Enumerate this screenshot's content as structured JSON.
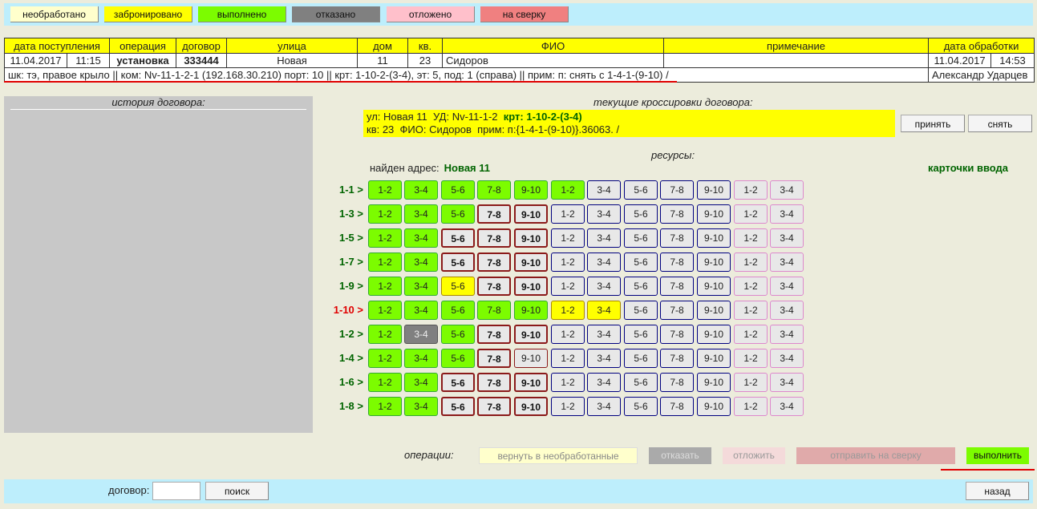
{
  "statuses": [
    {
      "label": "необработано",
      "color": "#ffffcc"
    },
    {
      "label": "забронировано",
      "color": "#ffff00"
    },
    {
      "label": "выполнено",
      "color": "#7cfc00"
    },
    {
      "label": "отказано",
      "color": "#808080"
    },
    {
      "label": "отложено",
      "color": "#ffc0cb"
    },
    {
      "label": "на сверку",
      "color": "#f08080"
    }
  ],
  "table": {
    "headers": [
      "дата поступления",
      "операция",
      "договор",
      "улица",
      "дом",
      "кв.",
      "ФИО",
      "примечание",
      "дата обработки"
    ],
    "values": {
      "date_in": "11.04.2017",
      "time_in": "11:15",
      "operation": "установка",
      "contract": "333444",
      "street": "Новая",
      "house": "11",
      "apt": "23",
      "fio": "Сидоров",
      "note": "",
      "date_out": "11.04.2017",
      "time_out": "14:53"
    },
    "details": "шк: тэ, правое крыло || ком: Nv-11-1-2-1 (192.168.30.210) порт: 10 || крт: 1-10-2-(3-4), эт: 5, под: 1 (справа) || прим: п: снять с 1-4-1-(9-10) /",
    "operator": "Александр Ударцев"
  },
  "history": {
    "title": "история договора:"
  },
  "current": {
    "title": "текущие кроссировки договора:",
    "line1_prefix": "ул: Новая 11  УД: Nv-11-1-2  ",
    "line1_hl": "крт: 1-10-2-(3-4)",
    "line2": "кв: 23  ФИО: Сидоров  прим: п:{1-4-1-(9-10)}.36063. /",
    "accept_label": "принять",
    "remove_label": "снять"
  },
  "resources": {
    "title": "ресурсы:",
    "found_label": "найден адрес:",
    "found_value": "Новая 11",
    "cards_label": "карточки ввода",
    "rows": [
      {
        "label": "1-1 >",
        "red": false,
        "cells": [
          [
            "1-2",
            "g"
          ],
          [
            "3-4",
            "g"
          ],
          [
            "5-6",
            "g"
          ],
          [
            "7-8",
            "g"
          ],
          [
            "9-10",
            "g"
          ],
          [
            "1-2",
            "g"
          ],
          [
            "3-4",
            "n"
          ],
          [
            "5-6",
            "n"
          ],
          [
            "7-8",
            "n"
          ],
          [
            "9-10",
            "n"
          ],
          [
            "1-2",
            "p"
          ],
          [
            "3-4",
            "p"
          ]
        ]
      },
      {
        "label": "1-3 >",
        "red": false,
        "cells": [
          [
            "1-2",
            "g"
          ],
          [
            "3-4",
            "g"
          ],
          [
            "5-6",
            "g"
          ],
          [
            "7-8",
            "b"
          ],
          [
            "9-10",
            "b"
          ],
          [
            "1-2",
            "n"
          ],
          [
            "3-4",
            "n"
          ],
          [
            "5-6",
            "n"
          ],
          [
            "7-8",
            "n"
          ],
          [
            "9-10",
            "n"
          ],
          [
            "1-2",
            "p"
          ],
          [
            "3-4",
            "p"
          ]
        ]
      },
      {
        "label": "1-5 >",
        "red": false,
        "cells": [
          [
            "1-2",
            "g"
          ],
          [
            "3-4",
            "g"
          ],
          [
            "5-6",
            "b"
          ],
          [
            "7-8",
            "b"
          ],
          [
            "9-10",
            "b"
          ],
          [
            "1-2",
            "n"
          ],
          [
            "3-4",
            "n"
          ],
          [
            "5-6",
            "n"
          ],
          [
            "7-8",
            "n"
          ],
          [
            "9-10",
            "n"
          ],
          [
            "1-2",
            "p"
          ],
          [
            "3-4",
            "p"
          ]
        ]
      },
      {
        "label": "1-7 >",
        "red": false,
        "cells": [
          [
            "1-2",
            "g"
          ],
          [
            "3-4",
            "g"
          ],
          [
            "5-6",
            "b"
          ],
          [
            "7-8",
            "b"
          ],
          [
            "9-10",
            "b"
          ],
          [
            "1-2",
            "n"
          ],
          [
            "3-4",
            "n"
          ],
          [
            "5-6",
            "n"
          ],
          [
            "7-8",
            "n"
          ],
          [
            "9-10",
            "n"
          ],
          [
            "1-2",
            "p"
          ],
          [
            "3-4",
            "p"
          ]
        ]
      },
      {
        "label": "1-9 >",
        "red": false,
        "cells": [
          [
            "1-2",
            "g"
          ],
          [
            "3-4",
            "g"
          ],
          [
            "5-6",
            "y"
          ],
          [
            "7-8",
            "b"
          ],
          [
            "9-10",
            "b"
          ],
          [
            "1-2",
            "n"
          ],
          [
            "3-4",
            "n"
          ],
          [
            "5-6",
            "n"
          ],
          [
            "7-8",
            "n"
          ],
          [
            "9-10",
            "n"
          ],
          [
            "1-2",
            "p"
          ],
          [
            "3-4",
            "p"
          ]
        ]
      },
      {
        "label": "1-10 >",
        "red": true,
        "cells": [
          [
            "1-2",
            "g"
          ],
          [
            "3-4",
            "g"
          ],
          [
            "5-6",
            "g"
          ],
          [
            "7-8",
            "g"
          ],
          [
            "9-10",
            "g"
          ],
          [
            "1-2",
            "y"
          ],
          [
            "3-4",
            "y"
          ],
          [
            "5-6",
            "n"
          ],
          [
            "7-8",
            "n"
          ],
          [
            "9-10",
            "n"
          ],
          [
            "1-2",
            "p"
          ],
          [
            "3-4",
            "p"
          ]
        ]
      },
      {
        "label": "1-2 >",
        "red": false,
        "cells": [
          [
            "1-2",
            "g"
          ],
          [
            "3-4",
            "d"
          ],
          [
            "5-6",
            "g"
          ],
          [
            "7-8",
            "b"
          ],
          [
            "9-10",
            "b"
          ],
          [
            "1-2",
            "n"
          ],
          [
            "3-4",
            "n"
          ],
          [
            "5-6",
            "n"
          ],
          [
            "7-8",
            "n"
          ],
          [
            "9-10",
            "n"
          ],
          [
            "1-2",
            "p"
          ],
          [
            "3-4",
            "p"
          ]
        ]
      },
      {
        "label": "1-4 >",
        "red": false,
        "cells": [
          [
            "1-2",
            "g"
          ],
          [
            "3-4",
            "g"
          ],
          [
            "5-6",
            "g"
          ],
          [
            "7-8",
            "b"
          ],
          [
            "9-10",
            "l"
          ],
          [
            "1-2",
            "n"
          ],
          [
            "3-4",
            "n"
          ],
          [
            "5-6",
            "n"
          ],
          [
            "7-8",
            "n"
          ],
          [
            "9-10",
            "n"
          ],
          [
            "1-2",
            "p"
          ],
          [
            "3-4",
            "p"
          ]
        ]
      },
      {
        "label": "1-6 >",
        "red": false,
        "cells": [
          [
            "1-2",
            "g"
          ],
          [
            "3-4",
            "g"
          ],
          [
            "5-6",
            "b"
          ],
          [
            "7-8",
            "b"
          ],
          [
            "9-10",
            "b"
          ],
          [
            "1-2",
            "n"
          ],
          [
            "3-4",
            "n"
          ],
          [
            "5-6",
            "n"
          ],
          [
            "7-8",
            "n"
          ],
          [
            "9-10",
            "n"
          ],
          [
            "1-2",
            "p"
          ],
          [
            "3-4",
            "p"
          ]
        ]
      },
      {
        "label": "1-8 >",
        "red": false,
        "cells": [
          [
            "1-2",
            "g"
          ],
          [
            "3-4",
            "g"
          ],
          [
            "5-6",
            "b"
          ],
          [
            "7-8",
            "b"
          ],
          [
            "9-10",
            "b"
          ],
          [
            "1-2",
            "n"
          ],
          [
            "3-4",
            "n"
          ],
          [
            "5-6",
            "n"
          ],
          [
            "7-8",
            "n"
          ],
          [
            "9-10",
            "n"
          ],
          [
            "1-2",
            "p"
          ],
          [
            "3-4",
            "p"
          ]
        ]
      }
    ]
  },
  "operations": {
    "label": "операции:",
    "return_label": "вернуть в необработанные",
    "reject_label": "отказать",
    "postpone_label": "отложить",
    "verify_label": "отправить на сверку",
    "done_label": "выполнить"
  },
  "bottom": {
    "contract_label": "договор:",
    "contract_value": "",
    "search_label": "поиск",
    "back_label": "назад"
  }
}
